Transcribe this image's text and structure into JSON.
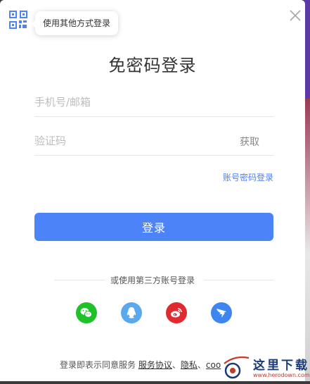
{
  "colors": {
    "primary": "#4d83f8",
    "link": "#4a7ff5",
    "wechat": "#1ec12a",
    "qq": "#5aa9ec",
    "weibo": "#e12a2f",
    "dingtalk": "#3d85f0"
  },
  "header": {
    "qr_icon": "qr-code-icon",
    "tooltip": "使用其他方式登录",
    "close_icon": "close-icon"
  },
  "title": "免密码登录",
  "form": {
    "phone_placeholder": "手机号/邮箱",
    "code_placeholder": "验证码",
    "get_code_label": "获取",
    "account_login_link": "账号密码登录",
    "login_button": "登录"
  },
  "third_party": {
    "divider_text": "或使用第三方账号登录",
    "providers": [
      {
        "name": "wechat",
        "icon": "wechat-icon"
      },
      {
        "name": "qq",
        "icon": "qq-icon"
      },
      {
        "name": "weibo",
        "icon": "weibo-icon"
      },
      {
        "name": "dingtalk",
        "icon": "dingtalk-icon"
      }
    ]
  },
  "agreement": {
    "prefix": "登录即表示同意服务",
    "service_link": "服务协议",
    "sep1": "、",
    "privacy_link": "隐私",
    "sep2": "、",
    "cookie_link": "coo"
  },
  "watermark": {
    "title": "这里下载",
    "url": "www.herodown.com"
  }
}
